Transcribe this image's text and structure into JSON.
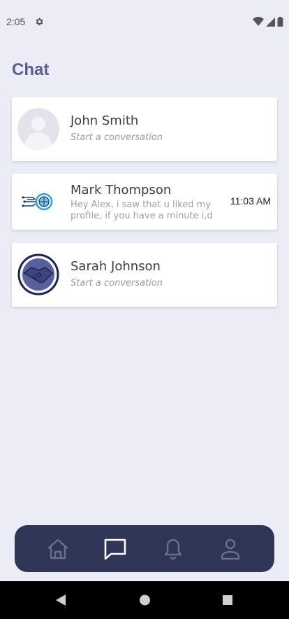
{
  "status_bar": {
    "time": "2:05"
  },
  "page": {
    "title": "Chat"
  },
  "chats": [
    {
      "name": "John Smith",
      "preview": "Start a conversation",
      "time": ""
    },
    {
      "name": "Mark Thompson",
      "preview": "Hey Alex, i saw that u liked my profile, if you have a minute i,d",
      "time": "11:03 AM"
    },
    {
      "name": "Sarah Johnson",
      "preview": "Start a conversation",
      "time": ""
    }
  ],
  "nav": {
    "items": [
      "home-icon",
      "chat-icon",
      "bell-icon",
      "person-icon"
    ],
    "active": "chat-icon"
  },
  "colors": {
    "background": "#ececf6",
    "title": "#5a5d90",
    "nav_bar": "#2f3554",
    "nav_icon": "#6a6f90",
    "nav_active": "#ffffff"
  }
}
